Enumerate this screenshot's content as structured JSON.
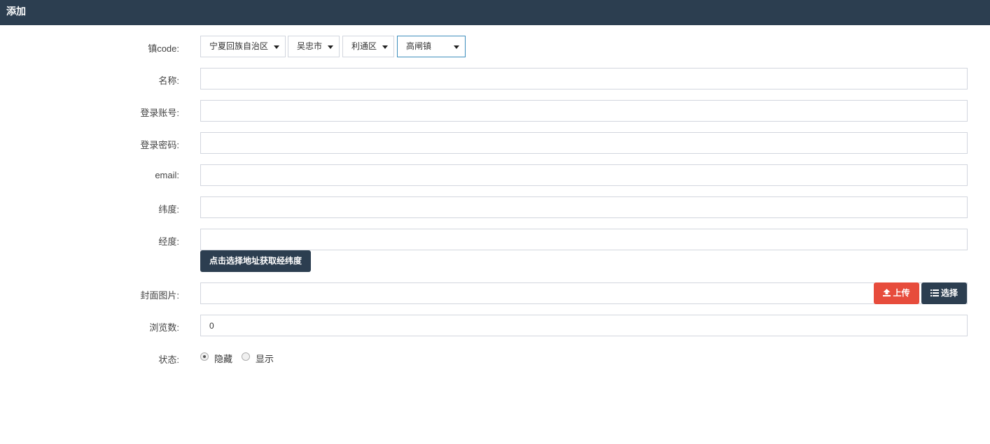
{
  "header": {
    "title": "添加"
  },
  "form": {
    "town_code": {
      "label": "镇code:",
      "province": "宁夏回族自治区",
      "city": "吴忠市",
      "district": "利通区",
      "town": "高闸镇"
    },
    "name": {
      "label": "名称:",
      "value": ""
    },
    "account": {
      "label": "登录账号:",
      "value": ""
    },
    "password": {
      "label": "登录密码:",
      "value": ""
    },
    "email": {
      "label": "email:",
      "value": ""
    },
    "latitude": {
      "label": "纬度:",
      "value": ""
    },
    "longitude": {
      "label": "经度:",
      "value": ""
    },
    "pick_location_button": "点击选择地址获取经纬度",
    "cover": {
      "label": "封面图片:",
      "value": "",
      "upload_label": "上传",
      "select_label": "选择"
    },
    "views": {
      "label": "浏览数:",
      "value": "0"
    },
    "status": {
      "label": "状态:",
      "options": [
        "隐藏",
        "显示"
      ],
      "selected": "隐藏"
    }
  },
  "colors": {
    "header_bg": "#2c3e50",
    "upload_btn": "#e74c3c",
    "dark_btn": "#2c3e50"
  },
  "icons": {
    "upload": "upload-icon",
    "select": "list-icon",
    "dropdown": "caret-down-icon"
  }
}
